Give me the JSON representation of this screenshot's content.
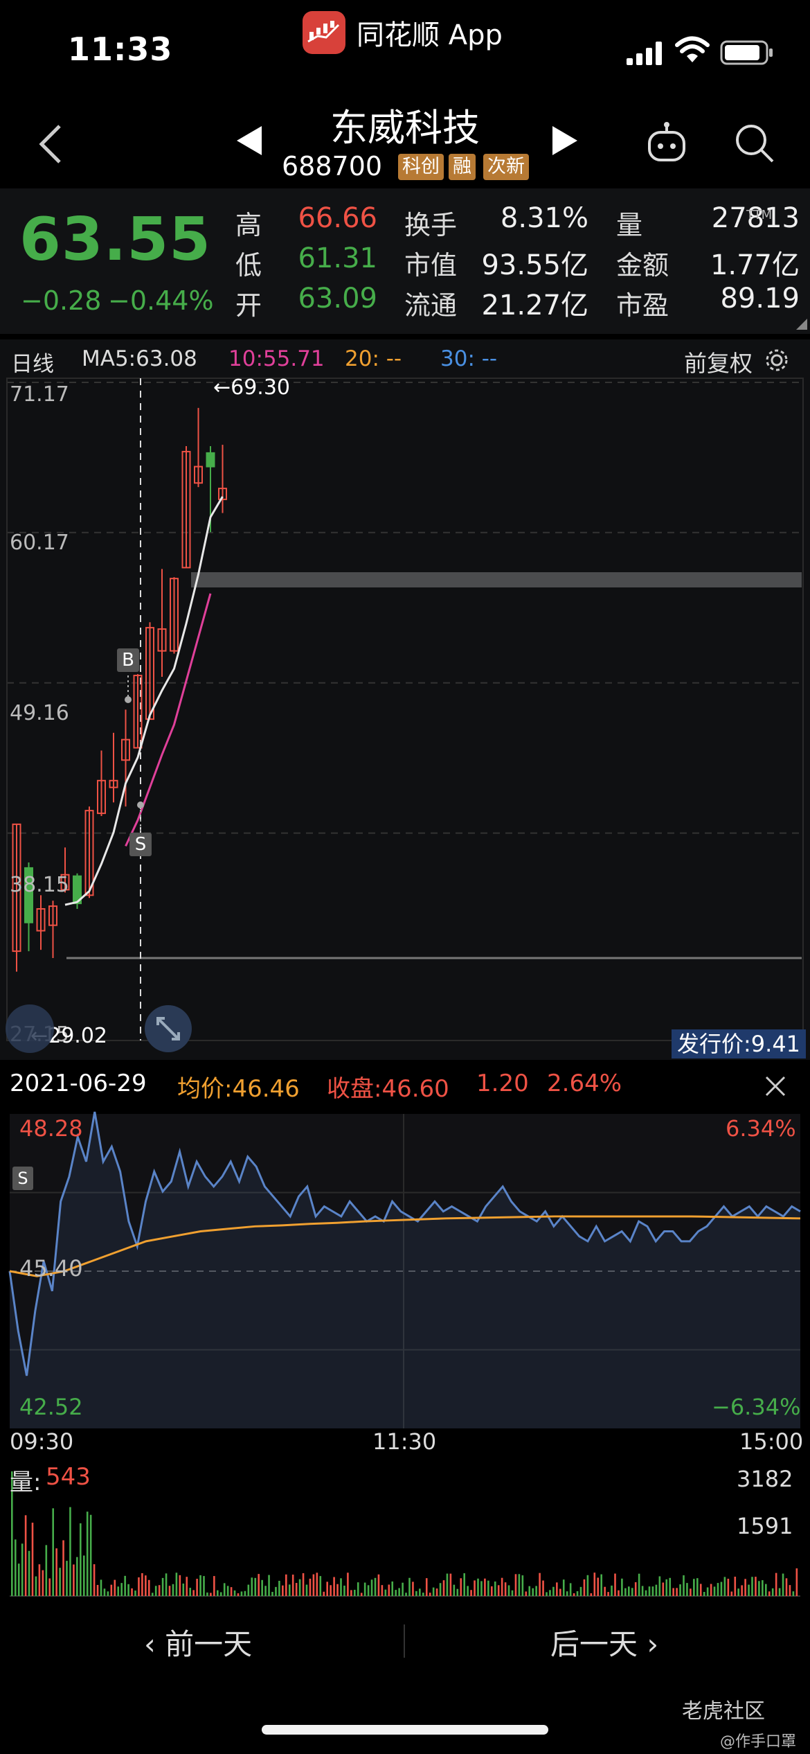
{
  "status_bar": {
    "time": "11:33",
    "app_name": "同花顺 App"
  },
  "header": {
    "stock_name": "东威科技",
    "stock_code": "688700",
    "tags": [
      "科创",
      "融",
      "次新"
    ]
  },
  "quote": {
    "price": "63.55",
    "change": "−0.28",
    "change_pct": "−0.44%",
    "rows": [
      [
        {
          "label": "高",
          "value": "66.66",
          "color": "#ef5245"
        },
        {
          "label": "换手",
          "value": "8.31%",
          "color": "#f0f0f0"
        },
        {
          "label": "量",
          "value": "27813",
          "color": "#f0f0f0"
        }
      ],
      [
        {
          "label": "低",
          "value": "61.31",
          "color": "#46ad4a"
        },
        {
          "label": "市值",
          "value": "93.55亿",
          "color": "#f0f0f0"
        },
        {
          "label": "金额",
          "value": "1.77亿",
          "color": "#f0f0f0"
        }
      ],
      [
        {
          "label": "开",
          "value": "63.09",
          "color": "#46ad4a"
        },
        {
          "label": "流通",
          "value": "21.27亿",
          "color": "#f0f0f0"
        },
        {
          "label": "市盈",
          "value": "89.19",
          "color": "#f0f0f0"
        }
      ]
    ],
    "pe_superscript": "TTM"
  },
  "kline": {
    "period_label": "日线",
    "ma5": "MA5:63.08",
    "ma10": "10:55.71",
    "ma20": "20: --",
    "ma30": "30: --",
    "adjust_label": "前复权",
    "y_ticks": [
      "71.17",
      "60.17",
      "49.16",
      "38.15",
      "27.15"
    ],
    "high_marker": "←69.30",
    "low_marker": "←29.02",
    "issue_price": "发行价:9.41",
    "buy_marker": "B",
    "sell_marker": "S",
    "colors": {
      "up": "#ef5245",
      "down": "#46ad4a",
      "ma5": "#e8e8e8",
      "ma10": "#e0409a",
      "ma20": "#f0a030",
      "ma30": "#4a90e2"
    },
    "candles": [
      {
        "o": 29.5,
        "c": 38.8,
        "h": 38.8,
        "l": 28.0
      },
      {
        "o": 35.6,
        "c": 31.6,
        "h": 36.0,
        "l": 29.5
      },
      {
        "o": 31.0,
        "c": 32.6,
        "h": 33.6,
        "l": 29.6
      },
      {
        "o": 31.4,
        "c": 32.8,
        "h": 33.2,
        "l": 29.0
      },
      {
        "o": 34.0,
        "c": 35.1,
        "h": 37.1,
        "l": 33.8
      },
      {
        "o": 35.0,
        "c": 33.0,
        "h": 35.2,
        "l": 32.6
      },
      {
        "o": 33.6,
        "c": 39.8,
        "h": 40.1,
        "l": 33.4
      },
      {
        "o": 39.6,
        "c": 42.0,
        "h": 44.2,
        "l": 39.4
      },
      {
        "o": 41.5,
        "c": 42.0,
        "h": 45.5,
        "l": 40.4
      },
      {
        "o": 43.5,
        "c": 45.0,
        "h": 47.2,
        "l": 40.1
      },
      {
        "o": 44.4,
        "c": 49.7,
        "h": 49.8,
        "l": 44.4
      },
      {
        "o": 46.5,
        "c": 53.2,
        "h": 53.6,
        "l": 46.5
      },
      {
        "o": 51.5,
        "c": 53.1,
        "h": 57.5,
        "l": 49.6
      },
      {
        "o": 51.5,
        "c": 56.8,
        "h": 56.9,
        "l": 51.3
      },
      {
        "o": 57.6,
        "c": 66.1,
        "h": 66.5,
        "l": 57.6
      },
      {
        "o": 63.8,
        "c": 65.0,
        "h": 69.3,
        "l": 63.5
      },
      {
        "o": 66.0,
        "c": 65.0,
        "h": 66.5,
        "l": 60.2
      },
      {
        "o": 62.6,
        "c": 63.4,
        "h": 66.6,
        "l": 61.6
      }
    ],
    "ma5_line": [
      null,
      null,
      null,
      null,
      32.9,
      33.1,
      33.9,
      35.9,
      38.2,
      41.8,
      43.7,
      46.8,
      48.6,
      50.2,
      53.5,
      57.1,
      61.3,
      62.8
    ],
    "ma10_line": [
      null,
      null,
      null,
      null,
      null,
      null,
      null,
      null,
      null,
      37.2,
      39.1,
      41.5,
      43.9,
      46.1,
      49.3,
      52.5,
      55.7
    ]
  },
  "intraday": {
    "date": "2021-06-29",
    "avg": "均价:46.46",
    "close": "收盘:46.60",
    "change": "1.20",
    "pct": "2.64%",
    "y_top": "48.28",
    "y_mid": "45.40",
    "y_bottom": "42.52",
    "pct_top": "6.34%",
    "pct_bottom": "−6.34%",
    "times": [
      "09:30",
      "11:30",
      "15:00"
    ],
    "volume_label": "量:",
    "volume_value": "543",
    "vol_ticks": [
      "3182",
      "1591"
    ],
    "sell_marker": "S",
    "price_line": [
      45.4,
      44.2,
      43.3,
      44.6,
      45.6,
      45.0,
      46.8,
      47.3,
      48.1,
      47.6,
      48.6,
      47.6,
      47.9,
      47.4,
      46.4,
      45.9,
      46.8,
      47.4,
      47.0,
      47.2,
      47.8,
      47.1,
      47.6,
      47.3,
      47.1,
      47.3,
      47.6,
      47.2,
      47.7,
      47.5,
      47.1,
      46.9,
      46.7,
      46.5,
      46.9,
      47.1,
      46.5,
      46.7,
      46.6,
      46.5,
      46.8,
      46.6,
      46.4,
      46.5,
      46.4,
      46.8,
      46.6,
      46.5,
      46.4,
      46.6,
      46.8,
      46.6,
      46.7,
      46.6,
      46.5,
      46.4,
      46.7,
      46.9,
      47.1,
      46.8,
      46.6,
      46.5,
      46.4,
      46.6,
      46.3,
      46.5,
      46.3,
      46.1,
      46.0,
      46.3,
      46.0,
      46.1,
      46.2,
      46.0,
      46.4,
      46.3,
      46.0,
      46.2,
      46.2,
      46.0,
      46.0,
      46.2,
      46.3,
      46.5,
      46.7,
      46.5,
      46.6,
      46.7,
      46.5,
      46.7,
      46.6,
      46.5,
      46.7,
      46.6
    ],
    "avg_line": [
      45.4,
      45.3,
      45.4,
      45.6,
      45.8,
      46.0,
      46.1,
      46.2,
      46.25,
      46.3,
      46.32,
      46.35,
      46.37,
      46.4,
      46.42,
      46.44,
      46.46,
      46.47,
      46.48,
      46.49,
      46.5,
      46.5,
      46.5,
      46.5,
      46.5,
      46.5,
      46.49,
      46.48,
      46.47,
      46.46
    ]
  },
  "footer": {
    "prev_day": "前一天",
    "next_day": "后一天",
    "watermark": "老虎社区",
    "watermark2": "@作手口罩"
  }
}
